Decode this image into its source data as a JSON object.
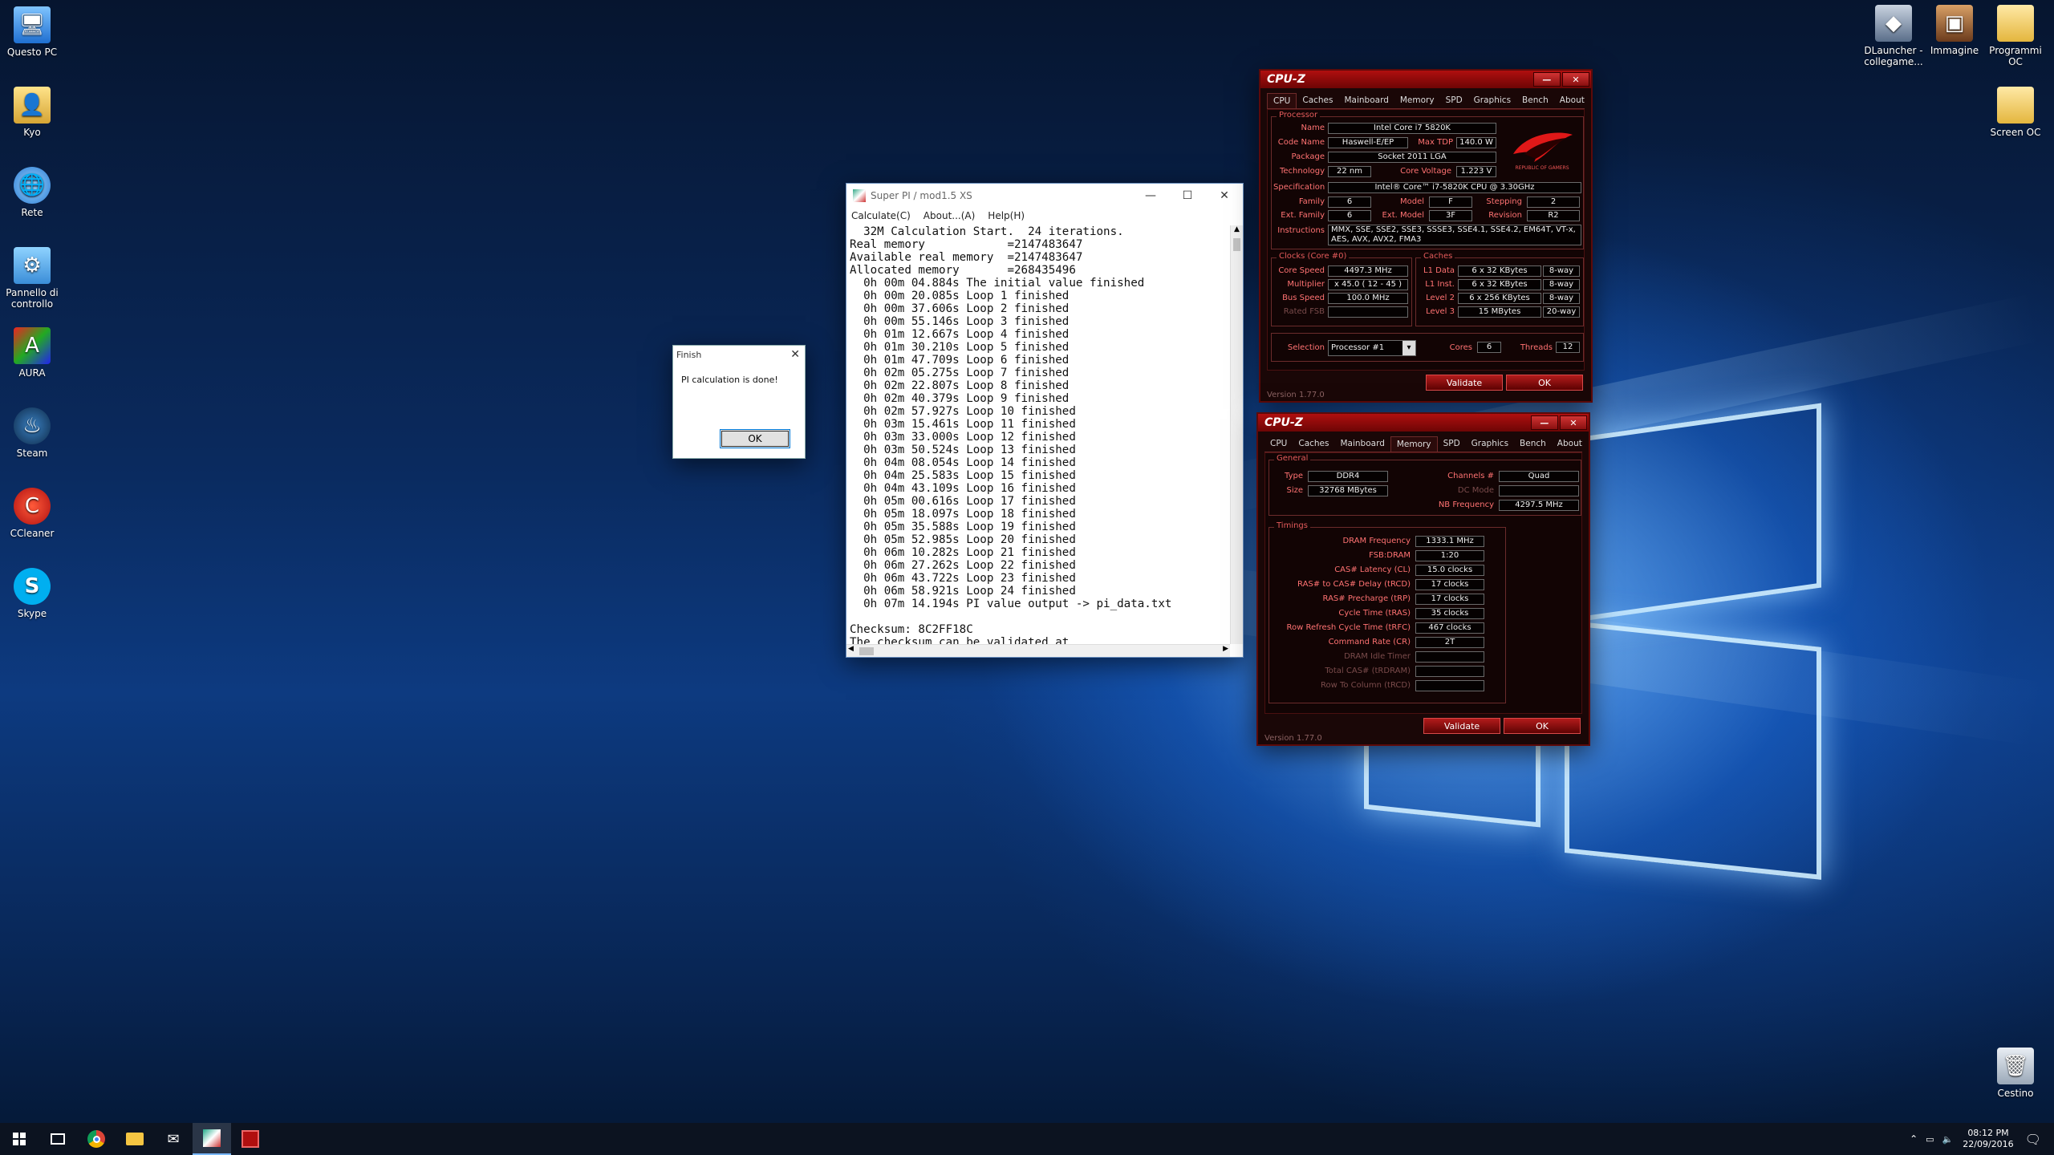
{
  "desktop": {
    "left_icons": [
      {
        "label": "Questo PC",
        "icon": "computer-icon"
      },
      {
        "label": "Kyo",
        "icon": "user-folder-icon"
      },
      {
        "label": "Rete",
        "icon": "network-icon"
      },
      {
        "label": "Pannello di controllo",
        "icon": "control-panel-icon"
      },
      {
        "label": "AURA",
        "icon": "aura-icon"
      },
      {
        "label": "Steam",
        "icon": "steam-icon"
      },
      {
        "label": "CCleaner",
        "icon": "ccleaner-icon"
      },
      {
        "label": "Skype",
        "icon": "skype-icon"
      }
    ],
    "right_icons": [
      {
        "label": "DLauncher - collegame...",
        "icon": "dlauncher-icon"
      },
      {
        "label": "Immagine",
        "icon": "image-icon"
      },
      {
        "label": "Programmi OC",
        "icon": "folder-icon"
      },
      {
        "label": "Screen OC",
        "icon": "folder-icon"
      },
      {
        "label": "Cestino",
        "icon": "recycle-bin-icon"
      }
    ]
  },
  "finish_dialog": {
    "title": "Finish",
    "message": "PI calculation is done!",
    "ok_label": "OK"
  },
  "superpi": {
    "title": "Super PI / mod1.5 XS",
    "menu": [
      "Calculate(C)",
      "About...(A)",
      "Help(H)"
    ],
    "console_lines": [
      "  32M Calculation Start.  24 iterations.",
      "Real memory            =2147483647",
      "Available real memory  =2147483647",
      "Allocated memory       =268435496",
      "  0h 00m 04.884s The initial value finished",
      "  0h 00m 20.085s Loop 1 finished",
      "  0h 00m 37.606s Loop 2 finished",
      "  0h 00m 55.146s Loop 3 finished",
      "  0h 01m 12.667s Loop 4 finished",
      "  0h 01m 30.210s Loop 5 finished",
      "  0h 01m 47.709s Loop 6 finished",
      "  0h 02m 05.275s Loop 7 finished",
      "  0h 02m 22.807s Loop 8 finished",
      "  0h 02m 40.379s Loop 9 finished",
      "  0h 02m 57.927s Loop 10 finished",
      "  0h 03m 15.461s Loop 11 finished",
      "  0h 03m 33.000s Loop 12 finished",
      "  0h 03m 50.524s Loop 13 finished",
      "  0h 04m 08.054s Loop 14 finished",
      "  0h 04m 25.583s Loop 15 finished",
      "  0h 04m 43.109s Loop 16 finished",
      "  0h 05m 00.616s Loop 17 finished",
      "  0h 05m 18.097s Loop 18 finished",
      "  0h 05m 35.588s Loop 19 finished",
      "  0h 05m 52.985s Loop 20 finished",
      "  0h 06m 10.282s Loop 21 finished",
      "  0h 06m 27.262s Loop 22 finished",
      "  0h 06m 43.722s Loop 23 finished",
      "  0h 06m 58.921s Loop 24 finished",
      "  0h 07m 14.194s PI value output -> pi_data.txt",
      "",
      "Checksum: 8C2FF18C",
      "The checksum can be validated at"
    ]
  },
  "cpuz1": {
    "title": "CPU-Z",
    "tabs": [
      "CPU",
      "Caches",
      "Mainboard",
      "Memory",
      "SPD",
      "Graphics",
      "Bench",
      "About"
    ],
    "processor_label": "Processor",
    "name_label": "Name",
    "name": "Intel Core i7 5820K",
    "codename_label": "Code Name",
    "codename": "Haswell-E/EP",
    "maxtdp_label": "Max TDP",
    "maxtdp": "140.0 W",
    "package_label": "Package",
    "package": "Socket 2011 LGA",
    "technology_label": "Technology",
    "technology": "22 nm",
    "corevoltage_label": "Core Voltage",
    "corevoltage": "1.223 V",
    "spec_label": "Specification",
    "spec": "Intel® Core™ i7-5820K CPU @ 3.30GHz",
    "family_label": "Family",
    "family": "6",
    "model_label": "Model",
    "model": "F",
    "stepping_label": "Stepping",
    "stepping": "2",
    "extfamily_label": "Ext. Family",
    "extfamily": "6",
    "extmodel_label": "Ext. Model",
    "extmodel": "3F",
    "revision_label": "Revision",
    "revision": "R2",
    "instructions_label": "Instructions",
    "instructions": "MMX, SSE, SSE2, SSE3, SSSE3, SSE4.1, SSE4.2, EM64T, VT-x, AES, AVX, AVX2, FMA3",
    "clocks_label": "Clocks (Core #0)",
    "corespeed_label": "Core Speed",
    "corespeed": "4497.3 MHz",
    "multiplier_label": "Multiplier",
    "multiplier": "x 45.0 ( 12 - 45 )",
    "busspeed_label": "Bus Speed",
    "busspeed": "100.0 MHz",
    "ratedfsb_label": "Rated FSB",
    "ratedfsb": "",
    "caches_label": "Caches",
    "l1data_label": "L1 Data",
    "l1data": "6 x 32 KBytes",
    "l1data_way": "8-way",
    "l1inst_label": "L1 Inst.",
    "l1inst": "6 x 32 KBytes",
    "l1inst_way": "8-way",
    "l2_label": "Level 2",
    "l2": "6 x 256 KBytes",
    "l2_way": "8-way",
    "l3_label": "Level 3",
    "l3": "15 MBytes",
    "l3_way": "20-way",
    "selection_label": "Selection",
    "selection": "Processor #1",
    "cores_label": "Cores",
    "cores": "6",
    "threads_label": "Threads",
    "threads": "12",
    "validate_label": "Validate",
    "ok_label": "OK",
    "version": "Version 1.77.0",
    "logo_text": "REPUBLIC OF GAMERS"
  },
  "cpuz2": {
    "title": "CPU-Z",
    "tabs": [
      "CPU",
      "Caches",
      "Mainboard",
      "Memory",
      "SPD",
      "Graphics",
      "Bench",
      "About"
    ],
    "general_label": "General",
    "type_label": "Type",
    "type": "DDR4",
    "size_label": "Size",
    "size": "32768 MBytes",
    "channels_label": "Channels #",
    "channels": "Quad",
    "dcmode_label": "DC Mode",
    "dcmode": "",
    "nbfreq_label": "NB Frequency",
    "nbfreq": "4297.5 MHz",
    "timings_label": "Timings",
    "timings": [
      {
        "label": "DRAM Frequency",
        "value": "1333.1 MHz",
        "dim": false
      },
      {
        "label": "FSB:DRAM",
        "value": "1:20",
        "dim": false
      },
      {
        "label": "CAS# Latency (CL)",
        "value": "15.0 clocks",
        "dim": false
      },
      {
        "label": "RAS# to CAS# Delay (tRCD)",
        "value": "17 clocks",
        "dim": false
      },
      {
        "label": "RAS# Precharge (tRP)",
        "value": "17 clocks",
        "dim": false
      },
      {
        "label": "Cycle Time (tRAS)",
        "value": "35 clocks",
        "dim": false
      },
      {
        "label": "Row Refresh Cycle Time (tRFC)",
        "value": "467 clocks",
        "dim": false
      },
      {
        "label": "Command Rate (CR)",
        "value": "2T",
        "dim": false
      },
      {
        "label": "DRAM Idle Timer",
        "value": "",
        "dim": true
      },
      {
        "label": "Total CAS# (tRDRAM)",
        "value": "",
        "dim": true
      },
      {
        "label": "Row To Column (tRCD)",
        "value": "",
        "dim": true
      }
    ],
    "validate_label": "Validate",
    "ok_label": "OK",
    "version": "Version 1.77.0"
  },
  "taskbar": {
    "time": "08:12 PM",
    "date": "22/09/2016"
  },
  "colors": {
    "cpuz_red": "#b00f0f",
    "cpuz_label": "#ff7272",
    "desktop_blue": "#0d3a80"
  }
}
